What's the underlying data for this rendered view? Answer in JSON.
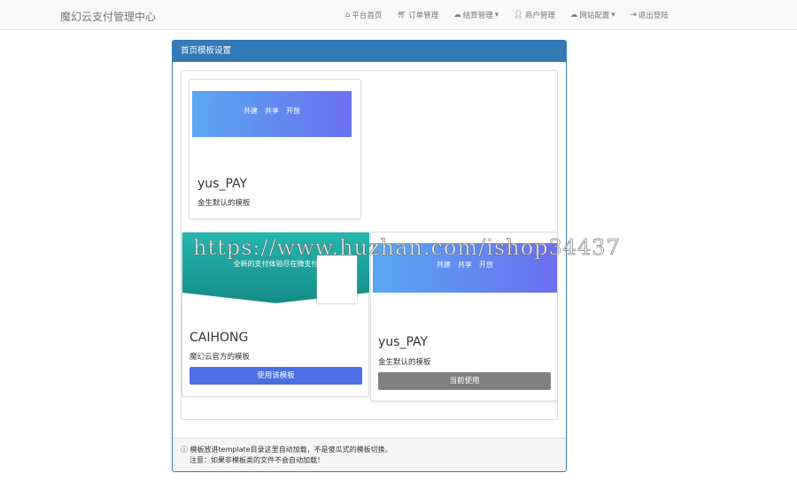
{
  "navbar": {
    "brand": "魔幻云支付管理中心",
    "items": [
      {
        "icon": "home-icon",
        "label": "平台首页",
        "dropdown": false
      },
      {
        "icon": "cart-icon",
        "label": "订单管理",
        "dropdown": false
      },
      {
        "icon": "cloud-icon",
        "label": "结算管理",
        "dropdown": true
      },
      {
        "icon": "user-icon",
        "label": "商户管理",
        "dropdown": false
      },
      {
        "icon": "cloud-icon",
        "label": "网站配置",
        "dropdown": true
      },
      {
        "icon": "logout-icon",
        "label": "退出登陆",
        "dropdown": false
      }
    ]
  },
  "panel": {
    "title": "首页模板设置"
  },
  "templates": [
    {
      "name": "yus_PAY",
      "desc": "金生默认的模板",
      "hero": "共建　共享　开放"
    },
    {
      "name": "CAIHONG",
      "desc": "魔幻云官方的模板",
      "hero": "全新的支付体验尽在微支付",
      "button": "使用该模板"
    },
    {
      "name": "yus_PAY",
      "desc": "金生默认的模板",
      "hero": "共建　共享　开放",
      "button": "当前使用"
    }
  ],
  "footer": {
    "line1": "模板放进template目录这里自动加载，不是傻瓜式的模板切换。",
    "line2": "注意：如果非模板类的文件不会自动加载！"
  },
  "watermark": "https://www.huzhan.com/ishop34437",
  "colors": {
    "primary": "#337ab7",
    "use_button": "#4a6fe3",
    "current_button": "#808080"
  }
}
